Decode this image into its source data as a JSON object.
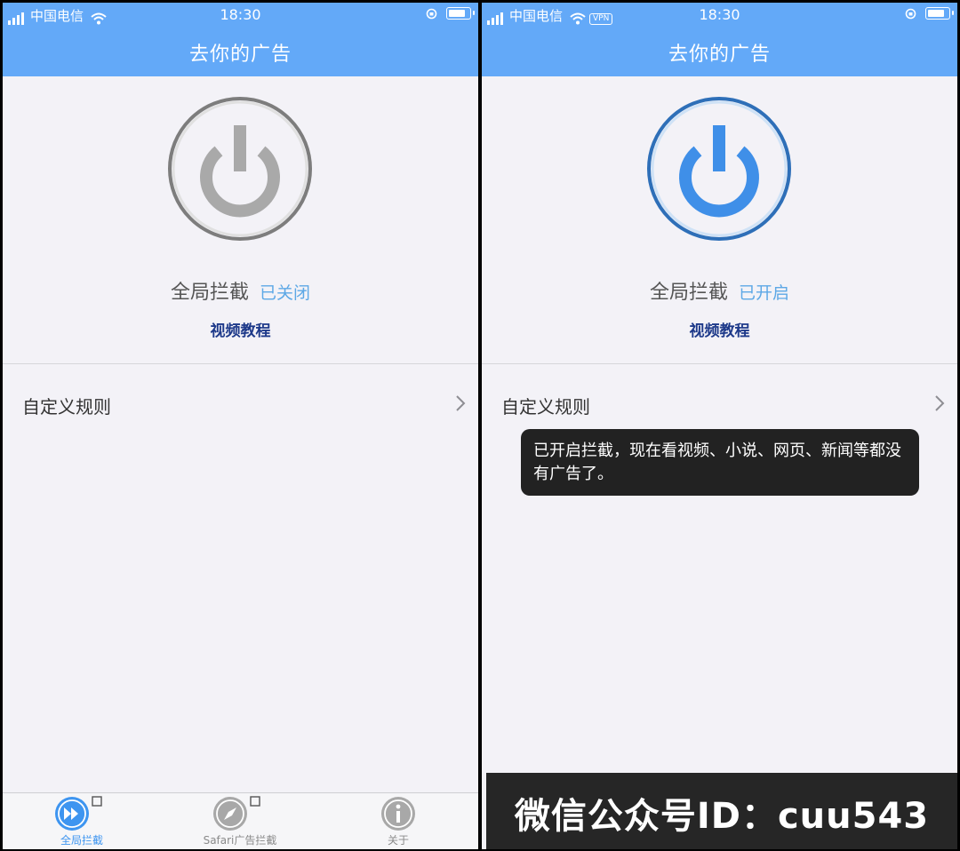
{
  "status_bar": {
    "carrier": "中国电信",
    "time": "18:30",
    "vpn": "VPN"
  },
  "left": {
    "title": "去你的广告",
    "label": "全局拦截",
    "state": "已关闭",
    "video_link": "视频教程",
    "rules_label": "自定义规则",
    "power_color": "#a9a9a9",
    "ring_color": "#7d7d7d",
    "tabs": [
      {
        "label": "全局拦截",
        "icon": "fast-forward-icon",
        "active": true
      },
      {
        "label": "Safari广告拦截",
        "icon": "compass-icon",
        "active": false
      },
      {
        "label": "关于",
        "icon": "info-icon",
        "active": false
      }
    ]
  },
  "right": {
    "title": "去你的广告",
    "label": "全局拦截",
    "state": "已开启",
    "video_link": "视频教程",
    "rules_label": "自定义规则",
    "power_color": "#3f8fe8",
    "ring_color": "#2e6fb8",
    "toast_message": "已开启拦截，现在看视频、小说、网页、新闻等都没有广告了。",
    "banner_text": "微信公众号ID：cuu543"
  },
  "colors": {
    "header": "#63a9f8",
    "tab_active": "#3e95f0",
    "tab_inactive": "#9a9a9a"
  }
}
